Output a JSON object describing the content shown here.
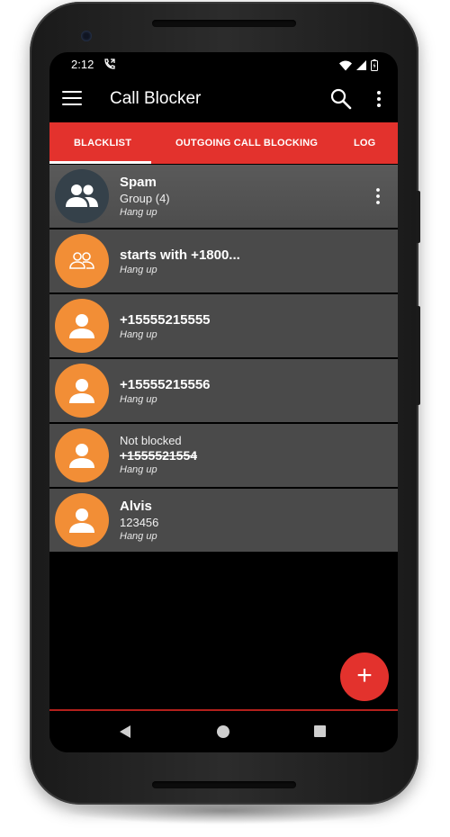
{
  "status_bar": {
    "time": "2:12",
    "icons": [
      "call-forward-icon",
      "wifi-icon",
      "signal-icon",
      "battery-icon"
    ]
  },
  "app_bar": {
    "title": "Call Blocker",
    "icons": [
      "menu-icon",
      "search-icon",
      "more-vert-icon"
    ]
  },
  "tabs": [
    {
      "label": "BLACKLIST",
      "selected": true
    },
    {
      "label": "OUTGOING CALL BLOCKING",
      "selected": false
    },
    {
      "label": "LOG",
      "selected": false
    }
  ],
  "blacklist": [
    {
      "avatar": "group-icon",
      "title": "Spam",
      "subtitle": "Group (4)",
      "action": "Hang up"
    },
    {
      "avatar": "group-outline-icon",
      "title": "starts with +1800...",
      "action": "Hang up"
    },
    {
      "avatar": "person-icon",
      "title": "+15555215555",
      "action": "Hang up"
    },
    {
      "avatar": "person-icon",
      "title": "+15555215556",
      "action": "Hang up"
    },
    {
      "avatar": "person-icon",
      "status": "Not blocked",
      "title": "+1555521554",
      "action": "Hang up"
    },
    {
      "avatar": "person-icon",
      "title": "Alvis",
      "subtitle": "123456",
      "action": "Hang up"
    }
  ],
  "fab": {
    "label": "+",
    "icon": "add-icon"
  },
  "nav_bar": {
    "icons": [
      "back-icon",
      "home-icon",
      "recents-icon"
    ]
  },
  "colors": {
    "accent": "#e3322d",
    "avatar_orange": "#f28e36",
    "avatar_dark": "#35414a",
    "row_background": "#4a4a4a",
    "screen_background": "#000000"
  }
}
